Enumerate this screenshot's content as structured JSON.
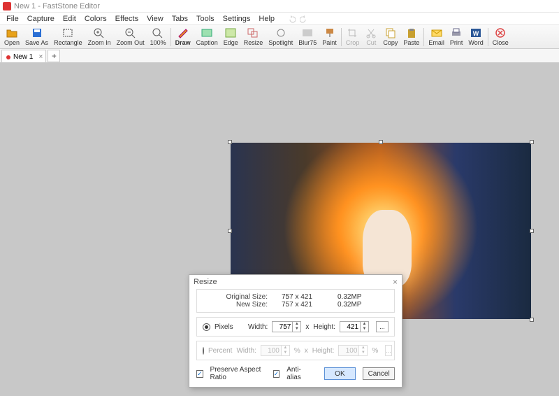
{
  "app": {
    "title": "New 1 - FastStone Editor"
  },
  "menu": [
    "File",
    "Capture",
    "Edit",
    "Colors",
    "Effects",
    "View",
    "Tabs",
    "Tools",
    "Settings",
    "Help"
  ],
  "toolbar": [
    {
      "id": "open",
      "label": "Open",
      "icon": "open-icon",
      "color": "#e8a21a"
    },
    {
      "id": "saveas",
      "label": "Save As",
      "icon": "save-icon",
      "color": "#2b6fd4"
    },
    {
      "id": "rect",
      "label": "Rectangle",
      "icon": "rect-icon",
      "color": "#444"
    },
    {
      "id": "zoomin",
      "label": "Zoom In",
      "icon": "zoomin-icon",
      "color": "#555"
    },
    {
      "id": "zoomout",
      "label": "Zoom Out",
      "icon": "zoomout-icon",
      "color": "#555"
    },
    {
      "id": "z100",
      "label": "100%",
      "icon": "zoom100-icon",
      "color": "#555"
    },
    {
      "sep": true
    },
    {
      "id": "draw",
      "label": "Draw",
      "icon": "draw-icon",
      "color": "#d43",
      "bold": true
    },
    {
      "id": "caption",
      "label": "Caption",
      "icon": "caption-icon",
      "color": "#3a7"
    },
    {
      "id": "edge",
      "label": "Edge",
      "icon": "edge-icon",
      "color": "#7a4"
    },
    {
      "id": "resize",
      "label": "Resize",
      "icon": "resize-icon",
      "color": "#c66"
    },
    {
      "id": "spot",
      "label": "Spotlight",
      "icon": "spot-icon",
      "color": "#888"
    },
    {
      "id": "blur",
      "label": "Blur75",
      "icon": "blur-icon",
      "color": "#888"
    },
    {
      "id": "paint",
      "label": "Paint",
      "icon": "paint-icon",
      "color": "#c84"
    },
    {
      "sep": true
    },
    {
      "id": "crop",
      "label": "Crop",
      "icon": "crop-icon",
      "color": "#bbb",
      "disabled": true
    },
    {
      "id": "cut",
      "label": "Cut",
      "icon": "cut-icon",
      "color": "#bbb",
      "disabled": true
    },
    {
      "id": "copy",
      "label": "Copy",
      "icon": "copy-icon",
      "color": "#c8a030"
    },
    {
      "id": "paste",
      "label": "Paste",
      "icon": "paste-icon",
      "color": "#c8a030"
    },
    {
      "sep": true
    },
    {
      "id": "email",
      "label": "Email",
      "icon": "email-icon",
      "color": "#e0b030"
    },
    {
      "id": "print",
      "label": "Print",
      "icon": "print-icon",
      "color": "#668"
    },
    {
      "id": "word",
      "label": "Word",
      "icon": "word-icon",
      "color": "#2b5797"
    },
    {
      "sep": true
    },
    {
      "id": "close",
      "label": "Close",
      "icon": "close-icon",
      "color": "#d44"
    }
  ],
  "tab": {
    "name": "New 1"
  },
  "resize": {
    "title": "Resize",
    "orig_label": "Original Size:",
    "orig_val": "757 x 421",
    "orig_mp": "0.32MP",
    "new_label": "New Size:",
    "new_val": "757 x 421",
    "new_mp": "0.32MP",
    "pixels_label": "Pixels",
    "percent_label": "Percent",
    "width_label": "Width:",
    "height_label": "Height:",
    "w_px": "757",
    "h_px": "421",
    "w_pc": "100",
    "h_pc": "100",
    "x": "x",
    "pct": "%",
    "more": "...",
    "preserve": "Preserve Aspect Ratio",
    "antialias": "Anti-alias",
    "ok": "OK",
    "cancel": "Cancel"
  }
}
